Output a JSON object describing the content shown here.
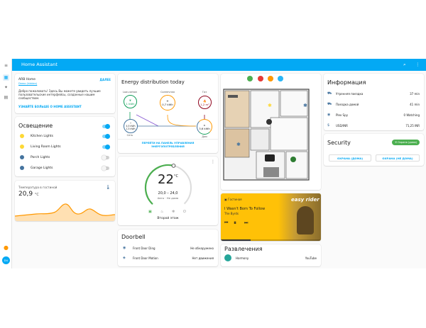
{
  "app": {
    "title": "Home Assistant"
  },
  "sidebar": {
    "user_initials": "DU"
  },
  "welcome": {
    "title": "ARB Home",
    "subtitle": "Demo (hidden)",
    "dismiss_label": "ДАЛЕЕ",
    "text": "Добро пожаловать! Здесь Вы можете увидеть лучшие пользовательские интерфейсы, созданные нашим сообществом.",
    "link_label": "УЗНАЙТЕ БОЛЬШЕ О HOME ASSISTANT"
  },
  "lights": {
    "title": "Освещение",
    "items": [
      {
        "label": "Kitchen Lights",
        "on": true,
        "color": "#fdd835"
      },
      {
        "label": "Living Room Lights",
        "on": true,
        "color": "#fdd835"
      },
      {
        "label": "Porch Lights",
        "on": false,
        "color": "#44739e"
      },
      {
        "label": "Garage Lights",
        "on": false,
        "color": "#44739e"
      }
    ]
  },
  "temperature": {
    "label": "Температура в гостиной",
    "value": "20,9",
    "unit": "°C",
    "accent": "#ff9800"
  },
  "energy": {
    "title": "Energy distribution today",
    "solar": {
      "label": "Солнечная",
      "value": "0,7 kWh"
    },
    "grid": {
      "label": "Сеть",
      "value": "4,5 kWh",
      "value2": "1,5 kWh"
    },
    "low_carbon": {
      "label": "Low-carbon",
      "value": "1 kWh"
    },
    "gas": {
      "label": "Газ",
      "value": "1,2 m³"
    },
    "home": {
      "label": "Дом",
      "value": "3,6 kWh"
    },
    "link1": "ПЕРЕЙТИ НА ПАНЕЛЬ УПРАВЛЕНИЯ",
    "link2": "ЭНЕРГОПОТРЕБЛЕНИЯ"
  },
  "thermostat": {
    "current": "22",
    "unit": "°C",
    "range": "20,0 – 24,0",
    "mode": "Авто · Не дома",
    "name": "Второй этаж",
    "level": 0.55,
    "color": "#4caf50"
  },
  "doorbell": {
    "title": "Doorbell",
    "rows": [
      {
        "label": "Front Door Ding",
        "value": "Не обнаружено"
      },
      {
        "label": "Front Door Motion",
        "value": "Нет движения"
      }
    ]
  },
  "media": {
    "source": "Гостиная",
    "track": "I Wasn't Born To Follow",
    "artist": "The Byrds",
    "art_text": "easy rider",
    "accent": "#ffc107"
  },
  "entertainment": {
    "title": "Развлечения",
    "device": "Harmony",
    "activity": "YouTube"
  },
  "info": {
    "title": "Информация",
    "rows": [
      {
        "label": "Утренняя поездка",
        "value": "37 min"
      },
      {
        "label": "Поездка домой",
        "value": "41 min"
      },
      {
        "label": "Plex Spy",
        "value": "0 Watching"
      },
      {
        "label": "USD/INR",
        "value": "71,25 INR"
      }
    ]
  },
  "security": {
    "title": "Security",
    "badge": "Охрана (дома)",
    "buttons": [
      "ОХРАНА (ДОМА)",
      "ОХРАНА (НЕ ДОМА)"
    ]
  }
}
